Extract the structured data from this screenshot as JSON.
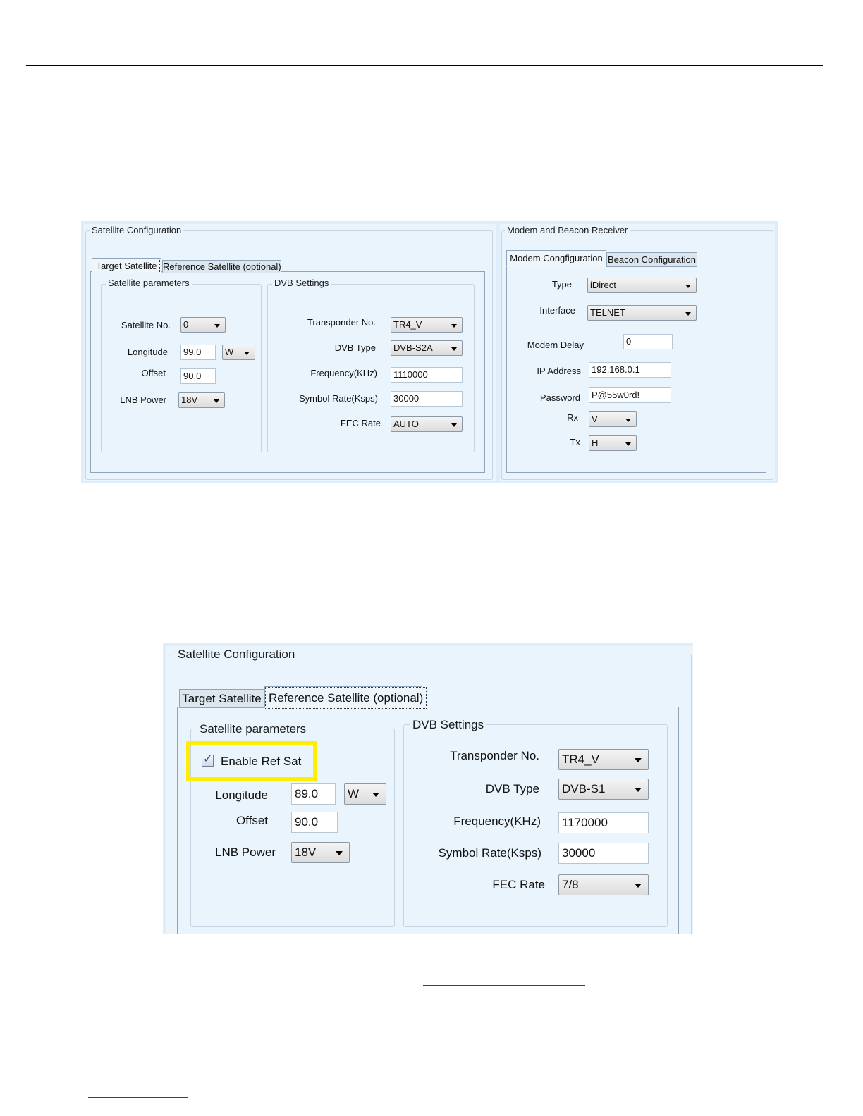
{
  "shot1": {
    "satellite_config": {
      "title": "Satellite Configuration",
      "tabs": [
        "Target Satellite",
        "Reference Satellite (optional)"
      ],
      "sat_params": {
        "title": "Satellite parameters",
        "sat_no_label": "Satellite No.",
        "sat_no_value": "0",
        "longitude_label": "Longitude",
        "longitude_value": "99.0",
        "longitude_dir": "W",
        "offset_label": "Offset",
        "offset_value": "90.0",
        "lnb_label": "LNB Power",
        "lnb_value": "18V"
      },
      "dvb": {
        "title": "DVB Settings",
        "transponder_label": "Transponder No.",
        "transponder_value": "TR4_V",
        "type_label": "DVB Type",
        "type_value": "DVB-S2A",
        "freq_label": "Frequency(KHz)",
        "freq_value": "1110000",
        "symbol_label": "Symbol Rate(Ksps)",
        "symbol_value": "30000",
        "fec_label": "FEC Rate",
        "fec_value": "AUTO"
      }
    },
    "modem_beacon": {
      "title": "Modem and Beacon Receiver",
      "tabs": [
        "Modem Congfiguration",
        "Beacon Configuration"
      ],
      "type_label": "Type",
      "type_value": "iDirect",
      "interface_label": "Interface",
      "interface_value": "TELNET",
      "delay_label": "Modem Delay",
      "delay_value": "0",
      "ip_label": "IP Address",
      "ip_value": "192.168.0.1",
      "password_label": "Password",
      "password_value": "P@55w0rd!",
      "rx_label": "Rx",
      "rx_value": "V",
      "tx_label": "Tx",
      "tx_value": "H"
    }
  },
  "shot2": {
    "title": "Satellite Configuration",
    "tabs": [
      "Target Satellite",
      "Reference Satellite (optional)"
    ],
    "sat_params": {
      "title": "Satellite parameters",
      "enable_label": "Enable Ref Sat",
      "enable_checked": true,
      "longitude_label": "Longitude",
      "longitude_value": "89.0",
      "longitude_dir": "W",
      "offset_label": "Offset",
      "offset_value": "90.0",
      "lnb_label": "LNB Power",
      "lnb_value": "18V"
    },
    "dvb": {
      "title": "DVB Settings",
      "transponder_label": "Transponder No.",
      "transponder_value": "TR4_V",
      "type_label": "DVB Type",
      "type_value": "DVB-S1",
      "freq_label": "Frequency(KHz)",
      "freq_value": "1170000",
      "symbol_label": "Symbol Rate(Ksps)",
      "symbol_value": "30000",
      "fec_label": "FEC Rate",
      "fec_value": "7/8"
    }
  },
  "colors": {
    "highlight": "#ffee00",
    "panel_bg": "#e9f4fc",
    "link": "#1f3fb0"
  }
}
